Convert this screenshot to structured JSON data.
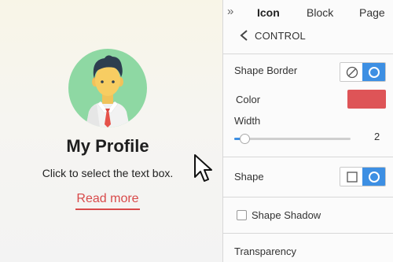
{
  "canvas": {
    "title": "My Profile",
    "text": "Click to select the text box.",
    "link": "Read more"
  },
  "panel": {
    "tabs": [
      "Icon",
      "Block",
      "Page"
    ],
    "active_tab": "Icon",
    "back_label": "CONTROL",
    "shape_border": {
      "label": "Shape Border",
      "selected": "circle"
    },
    "color": {
      "label": "Color",
      "value": "#de5457"
    },
    "width": {
      "label": "Width",
      "value": "2"
    },
    "shape": {
      "label": "Shape",
      "selected": "circle"
    },
    "shape_shadow": {
      "label": "Shape Shadow",
      "checked": false
    },
    "transparency": {
      "label": "Transparency"
    }
  },
  "colors": {
    "accent": "#3d8fe3",
    "link": "#d84a4a",
    "avatar_bg": "#8ed8a3"
  }
}
